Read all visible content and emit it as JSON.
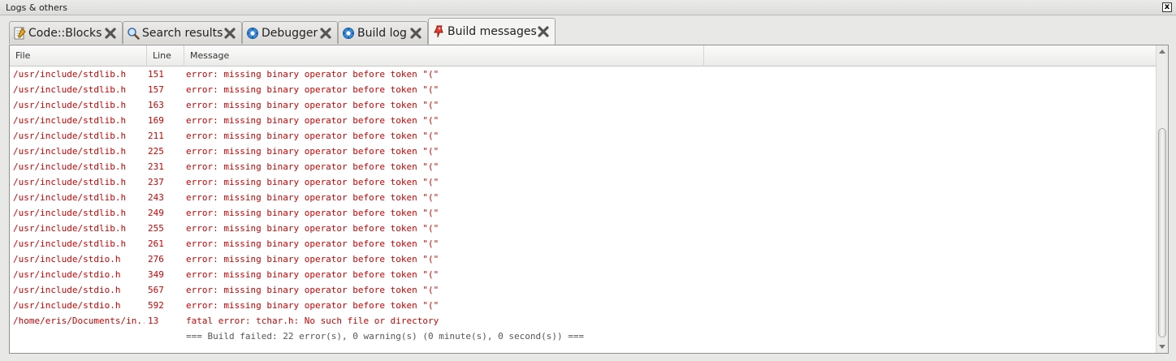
{
  "panel": {
    "title": "Logs & others",
    "close_symbol": "x"
  },
  "tabs": [
    {
      "label": "Code::Blocks",
      "icon": "note-icon"
    },
    {
      "label": "Search results",
      "icon": "magnifier-icon"
    },
    {
      "label": "Debugger",
      "icon": "cog-icon"
    },
    {
      "label": "Build log",
      "icon": "cog-icon"
    },
    {
      "label": "Build messages",
      "icon": "pin-icon",
      "active": true
    }
  ],
  "columns": {
    "file": "File",
    "line": "Line",
    "message": "Message"
  },
  "rows": [
    {
      "file": "/usr/include/stdlib.h",
      "line": "151",
      "message": "error: missing binary operator before token \"(\""
    },
    {
      "file": "/usr/include/stdlib.h",
      "line": "157",
      "message": "error: missing binary operator before token \"(\""
    },
    {
      "file": "/usr/include/stdlib.h",
      "line": "163",
      "message": "error: missing binary operator before token \"(\""
    },
    {
      "file": "/usr/include/stdlib.h",
      "line": "169",
      "message": "error: missing binary operator before token \"(\""
    },
    {
      "file": "/usr/include/stdlib.h",
      "line": "211",
      "message": "error: missing binary operator before token \"(\""
    },
    {
      "file": "/usr/include/stdlib.h",
      "line": "225",
      "message": "error: missing binary operator before token \"(\""
    },
    {
      "file": "/usr/include/stdlib.h",
      "line": "231",
      "message": "error: missing binary operator before token \"(\""
    },
    {
      "file": "/usr/include/stdlib.h",
      "line": "237",
      "message": "error: missing binary operator before token \"(\""
    },
    {
      "file": "/usr/include/stdlib.h",
      "line": "243",
      "message": "error: missing binary operator before token \"(\""
    },
    {
      "file": "/usr/include/stdlib.h",
      "line": "249",
      "message": "error: missing binary operator before token \"(\""
    },
    {
      "file": "/usr/include/stdlib.h",
      "line": "255",
      "message": "error: missing binary operator before token \"(\""
    },
    {
      "file": "/usr/include/stdlib.h",
      "line": "261",
      "message": "error: missing binary operator before token \"(\""
    },
    {
      "file": "/usr/include/stdio.h",
      "line": "276",
      "message": "error: missing binary operator before token \"(\""
    },
    {
      "file": "/usr/include/stdio.h",
      "line": "349",
      "message": "error: missing binary operator before token \"(\""
    },
    {
      "file": "/usr/include/stdio.h",
      "line": "567",
      "message": "error: missing binary operator before token \"(\""
    },
    {
      "file": "/usr/include/stdio.h",
      "line": "592",
      "message": "error: missing binary operator before token \"(\""
    },
    {
      "file": "/home/eris/Documents/in...",
      "line": "13",
      "message": "fatal error: tchar.h: No such file or directory"
    }
  ],
  "summary": "=== Build failed: 22 error(s), 0 warning(s) (0 minute(s), 0 second(s)) ===",
  "colors": {
    "error": "#d20000",
    "summary": "#555555"
  }
}
